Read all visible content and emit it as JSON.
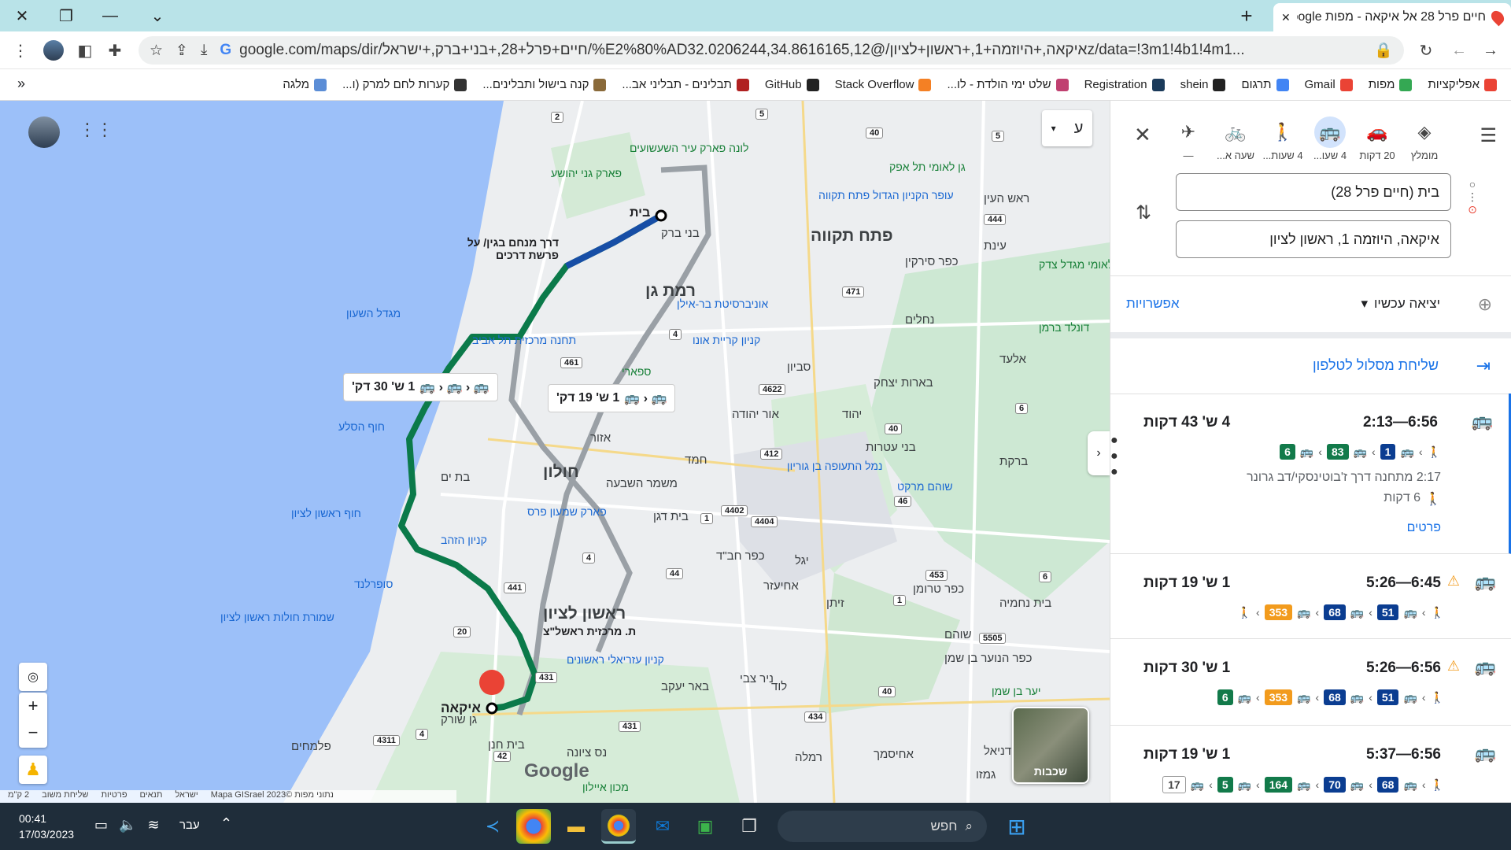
{
  "browser": {
    "tab_title": "חיים פרל 28 אל איקאה - מפות Google",
    "tab_close": "✕",
    "new_tab": "+",
    "url": "google.com/maps/dir/חיים+פרל+28,+בני+ברק,+ישראל/%E2%80%ADאיקאה,+היוזמה+1,+ראשון+לציון/@32.0206244,34.8616165,12z/data=!3m1!4b1!4m1...",
    "window_controls": [
      "✕",
      "❐",
      "—",
      "⌄"
    ]
  },
  "bookmarks": [
    {
      "label": "אפליקציות",
      "color": "#ea4335"
    },
    {
      "label": "מפות",
      "color": "#34a853"
    },
    {
      "label": "Gmail",
      "color": "#ea4335"
    },
    {
      "label": "תרגום",
      "color": "#4285f4"
    },
    {
      "label": "shein",
      "color": "#222222"
    },
    {
      "label": "Registration",
      "color": "#1a3a5a"
    },
    {
      "label": "שלט ימי הולדת - לו...",
      "color": "#c04070"
    },
    {
      "label": "Stack Overflow",
      "color": "#f48024"
    },
    {
      "label": "GitHub",
      "color": "#222222"
    },
    {
      "label": "תבלינים - תבליני אב...",
      "color": "#b02020"
    },
    {
      "label": "קנה בישול ותבלינים...",
      "color": "#8a6a3a"
    },
    {
      "label": "קערות לחם למרק (ו...",
      "color": "#333333"
    },
    {
      "label": "מלגה",
      "color": "#5b8dd6"
    }
  ],
  "bookmarks_overflow": "»",
  "panel": {
    "modes": [
      {
        "label": "מומלץ",
        "icon": "diamond-directions-icon"
      },
      {
        "label": "20 דקות",
        "icon": "car-icon"
      },
      {
        "label": "4 שעו...",
        "icon": "bus-icon",
        "selected": true
      },
      {
        "label": "4 שעות...",
        "icon": "walk-icon"
      },
      {
        "label": "שעה א...",
        "icon": "bike-icon"
      },
      {
        "label": "—",
        "icon": "plane-icon"
      }
    ],
    "origin": "בית (חיים פרל 28)",
    "destination": "איקאה, היוזמה 1, ראשון לציון",
    "depart": "יציאה עכשיו",
    "options": "אפשרויות",
    "send_to_phone": "שליחת מסלול לטלפון",
    "routes": [
      {
        "times": "2:13—6:56",
        "duration": "4 ש' 43 דקות",
        "warning": false,
        "lines": [
          {
            "num": "1",
            "color": "#0b3d91"
          },
          {
            "num": "83",
            "color": "#127a4a"
          },
          {
            "num": "6",
            "color": "#127a4a"
          }
        ],
        "detail1": "2:17 מתחנה דרך ז'בוטינסקי/דב גרונר",
        "detail2": "6 דקות",
        "details_link": "פרטים"
      },
      {
        "times": "5:26—6:45",
        "duration": "1 ש' 19 דקות",
        "warning": true,
        "lines": [
          {
            "num": "51",
            "color": "#0b3d91"
          },
          {
            "num": "68",
            "color": "#0b3d91"
          },
          {
            "num": "353",
            "color": "#f29b1d"
          }
        ],
        "walk_end": true
      },
      {
        "times": "5:26—6:56",
        "duration": "1 ש' 30 דקות",
        "warning": true,
        "lines": [
          {
            "num": "51",
            "color": "#0b3d91"
          },
          {
            "num": "68",
            "color": "#0b3d91"
          },
          {
            "num": "353",
            "color": "#f29b1d"
          },
          {
            "num": "6",
            "color": "#127a4a"
          }
        ]
      },
      {
        "times": "5:37—6:56",
        "duration": "1 ש' 19 דקות",
        "warning": false,
        "lines": [
          {
            "num": "68",
            "color": "#0b3d91"
          },
          {
            "num": "70",
            "color": "#0b3d91"
          },
          {
            "num": "164",
            "color": "#127a4a"
          },
          {
            "num": "5",
            "color": "#127a4a"
          },
          {
            "num": "17",
            "color": "#ffffff"
          }
        ]
      }
    ]
  },
  "map": {
    "callout_1": "1 ש' 30 דק'",
    "callout_2": "1 ש' 19 דק'",
    "origin_label": "בית",
    "dest_label": "איקאה",
    "route_note": "דרך מנחם בגין/ על פרשת דרכים",
    "station_label": "ת. מרכזית ראשל\"צ",
    "layers_label": "שכבות",
    "google": "Google",
    "mode_toggle": "ע",
    "cities": [
      {
        "t": "פתח תקווה",
        "big": true
      },
      {
        "t": "רמת גן",
        "big": true
      },
      {
        "t": "חולון",
        "big": true
      },
      {
        "t": "ראשון לציון",
        "big": true
      },
      {
        "t": "בני ברק"
      },
      {
        "t": "בת ים"
      },
      {
        "t": "אזור"
      },
      {
        "t": "אור יהודה"
      },
      {
        "t": "יהוד"
      },
      {
        "t": "סביון"
      },
      {
        "t": "ראש העין"
      },
      {
        "t": "כפר סירקין"
      },
      {
        "t": "נחלים"
      },
      {
        "t": "אלעד"
      },
      {
        "t": "בארות יצחק"
      },
      {
        "t": "בני עטרות"
      },
      {
        "t": "ברקת"
      },
      {
        "t": "חמד"
      },
      {
        "t": "משמר השבעה"
      },
      {
        "t": "בית דגן"
      },
      {
        "t": "כפר חב\"ד"
      },
      {
        "t": "יגל"
      },
      {
        "t": "אחיעזר"
      },
      {
        "t": "זיתן"
      },
      {
        "t": "כפר טרומן"
      },
      {
        "t": "שוהם"
      },
      {
        "t": "בית נחמיה"
      },
      {
        "t": "כפר הנוער בן שמן"
      },
      {
        "t": "נס ציונה"
      },
      {
        "t": "באר יעקב"
      },
      {
        "t": "רמלה"
      },
      {
        "t": "לוד"
      },
      {
        "t": "ניר צבי"
      },
      {
        "t": "בית חנן"
      },
      {
        "t": "גן שורק"
      },
      {
        "t": "פלמחים"
      },
      {
        "t": "אחיסמך"
      },
      {
        "t": "כפר דניאל"
      },
      {
        "t": "גמזו"
      },
      {
        "t": "עינת"
      }
    ],
    "pois": [
      {
        "t": "עופר הקניון הגדול פתח תקווה"
      },
      {
        "t": "אוניברסיטת בר-אילן"
      },
      {
        "t": "קניון קריית אונו"
      },
      {
        "t": "תחנה מרכזית תל אביב"
      },
      {
        "t": "מגדל השעון"
      },
      {
        "t": "חוף הסלע"
      },
      {
        "t": "חוף ראשון לציון"
      },
      {
        "t": "פארק שמעון פרס"
      },
      {
        "t": "קניון הזהב"
      },
      {
        "t": "סופרלנד"
      },
      {
        "t": "שמורת חולות ראשון לציון"
      },
      {
        "t": "קניון עזריאלי ראשונים"
      },
      {
        "t": "נמל התעופה בן גוריון"
      },
      {
        "t": "שוהם מרקט"
      },
      {
        "t": "גן לאומי תל אפק"
      },
      {
        "t": "גן לאומי מגדל צדק"
      },
      {
        "t": "לונה פארק עיר השעשועים"
      },
      {
        "t": "פארק גני יהושע"
      },
      {
        "t": "ספארי"
      },
      {
        "t": "דונלד ברמן"
      },
      {
        "t": "יער בן שמן"
      },
      {
        "t": "מכון איילון"
      }
    ],
    "footer": [
      "נתוני מפות ©2023 Mapa GISrael",
      "ישראל",
      "תנאים",
      "פרטיות",
      "שליחת משוב",
      "2 ק\"מ"
    ],
    "road_shields": [
      "2",
      "5",
      "40",
      "5",
      "444",
      "471",
      "4",
      "461",
      "4622",
      "412",
      "40",
      "6",
      "4402",
      "4404",
      "1",
      "44",
      "46",
      "453",
      "6",
      "4",
      "441",
      "20",
      "431",
      "431",
      "40",
      "434",
      "4",
      "42",
      "4311",
      "5505",
      "1",
      "6"
    ]
  },
  "taskbar": {
    "time": "00:41",
    "date": "17/03/2023",
    "lang": "עבר",
    "search_placeholder": "חפש"
  }
}
